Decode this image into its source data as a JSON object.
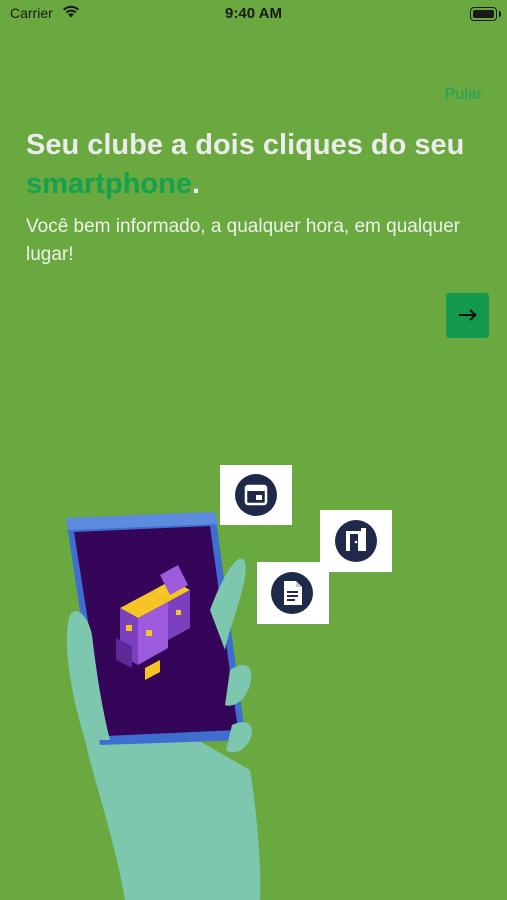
{
  "status_bar": {
    "carrier": "Carrier",
    "time": "9:40 AM"
  },
  "header": {
    "skip_label": "Pular"
  },
  "onboarding": {
    "title_main": "Seu clube a dois cliques do seu ",
    "title_highlight": "smartphone",
    "title_end": ".",
    "subtitle": "Você bem informado, a qualquer hora, em qualquer lugar!"
  },
  "icons": {
    "next": "arrow-right-icon",
    "cards": [
      "calendar-icon",
      "door-icon",
      "document-icon"
    ]
  },
  "colors": {
    "background": "#6aa840",
    "accent": "#149a4e",
    "title": "#ececec",
    "card_icon": "#1f2a4a"
  }
}
